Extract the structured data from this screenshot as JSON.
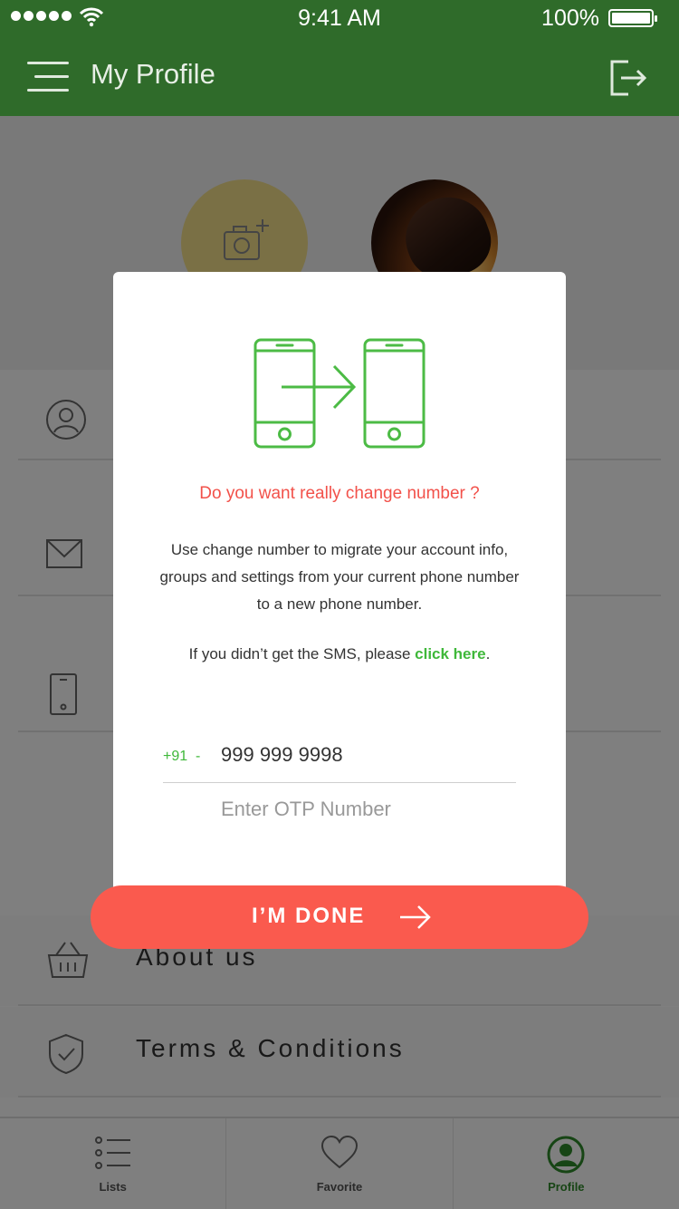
{
  "status_bar": {
    "time": "9:41 AM",
    "battery": "100%"
  },
  "header": {
    "title": "My Profile",
    "menu_icon": "menu-icon",
    "logout_icon": "logout-icon"
  },
  "profile": {
    "add_photo_icon": "camera-plus-icon",
    "avatar": "profile-photo"
  },
  "list": [
    {
      "icon": "user-icon",
      "label": ""
    },
    {
      "icon": "mail-icon",
      "label": ""
    },
    {
      "icon": "phone-icon",
      "label": ""
    },
    {
      "icon": "basket-icon",
      "label": "About us"
    },
    {
      "icon": "shield-check-icon",
      "label": "Terms & Conditions"
    }
  ],
  "tabs": [
    {
      "icon": "list-icon",
      "label": "Lists"
    },
    {
      "icon": "heart-icon",
      "label": "Favorite"
    },
    {
      "icon": "profile-icon",
      "label": "Profile",
      "active": true
    }
  ],
  "modal": {
    "illustration": "phone-transfer-icon",
    "question": "Do you want really change number ?",
    "desc_lines": [
      "Use change number to migrate your account info,",
      "groups and settings from your current phone number",
      "to a new phone number."
    ],
    "sms_text": "If you didn’t get the SMS, please ",
    "sms_link": "click here",
    "sms_end": ".",
    "country_code": "+91  -",
    "phone_number": "999 999 9998",
    "otp_placeholder": "Enter OTP Number",
    "done_label": "I’M DONE"
  },
  "colors": {
    "header": "#2f6b2a",
    "accent_green": "#3fb83a",
    "alert_red": "#f2514a",
    "button": "#fa5a4e"
  }
}
